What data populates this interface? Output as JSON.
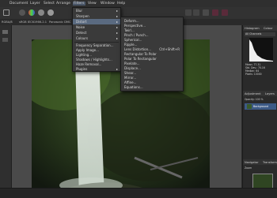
{
  "menubar": [
    "Layer",
    "Select",
    "Arrange",
    "Filters",
    "View",
    "Window",
    "Help",
    "Document"
  ],
  "context_bar": {
    "color_info": "RGBA/8",
    "profile": "sRGB IEC61966-2.1",
    "camera": "Panasonic DMC"
  },
  "filters_menu": {
    "items": [
      {
        "label": "Blur",
        "submenu": true
      },
      {
        "label": "Sharpen",
        "submenu": true
      },
      {
        "label": "Distort",
        "submenu": true,
        "highlighted": true
      },
      {
        "label": "Noise",
        "submenu": true
      },
      {
        "label": "Detect",
        "submenu": true
      },
      {
        "label": "Colours",
        "submenu": true
      },
      {
        "label": "Frequency Separation..."
      },
      {
        "label": "Apply Image..."
      },
      {
        "label": "Lighting..."
      },
      {
        "label": "Shadows / Highlights..."
      },
      {
        "label": "Haze Removal..."
      },
      {
        "label": "Plugins",
        "submenu": true
      }
    ]
  },
  "distort_menu": {
    "items": [
      {
        "label": "Deform..."
      },
      {
        "label": "Perspective..."
      },
      {
        "label": "Twirl..."
      },
      {
        "label": "Pinch / Punch..."
      },
      {
        "label": "Spherical..."
      },
      {
        "label": "Ripple..."
      },
      {
        "label": "Lens Distortion...",
        "shortcut": "Ctrl+Shift+R"
      },
      {
        "label": "Rectangular To Polar"
      },
      {
        "label": "Polar To Rectangular"
      },
      {
        "label": "Pixelate..."
      },
      {
        "label": "Displace..."
      },
      {
        "label": "Shear..."
      },
      {
        "label": "Mirror..."
      },
      {
        "label": "Affine..."
      },
      {
        "label": "Equations..."
      }
    ]
  },
  "right_panel": {
    "tabs": [
      "Histogram",
      "Colour"
    ],
    "channel_select": "All Channels",
    "stats": [
      "Mean: 77.31",
      "Std. Dev.: 70.16",
      "Median: 64",
      "Pixels: 10000"
    ],
    "adjustments_tabs": [
      "Adjustment",
      "Layers"
    ],
    "opacity_label": "Opacity: 100 %",
    "layer_name": "Background",
    "navigator_tabs": [
      "Navigator",
      "Transform"
    ],
    "zoom_label": "Zoom"
  },
  "colors": {
    "menu_bg": "#3a3a3a",
    "highlight": "#5a6a80",
    "panel_bg": "#2a2a2a",
    "canvas_bg": "#4a4a4a"
  }
}
